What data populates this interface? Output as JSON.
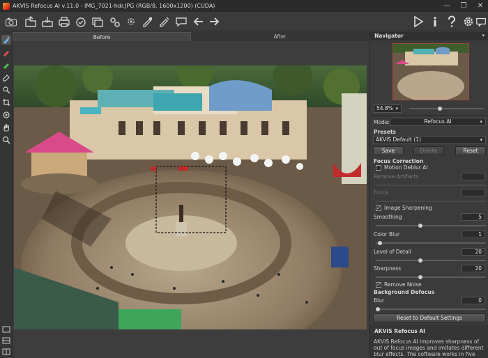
{
  "window": {
    "title": "AKVIS Refocus AI v.11.0 - IMG_7021-hdr.JPG (RGB/8, 1600x1200) (CUDA)"
  },
  "tabs": {
    "before": "Before",
    "after": "After"
  },
  "navigator": {
    "header": "Navigator",
    "zoom": "54.8%"
  },
  "mode": {
    "label": "Mode:",
    "value": "Refocus AI"
  },
  "presets": {
    "label": "Presets",
    "value": "AKVIS Default (1)",
    "save": "Save",
    "delete": "Delete",
    "reset": "Reset"
  },
  "focus": {
    "header": "Focus Correction",
    "motion_deblur": "Motion Deblur AI",
    "remove_artifacts": {
      "label": "Remove Artifacts",
      "value": ""
    },
    "focus": {
      "label": "Focus",
      "value": ""
    }
  },
  "sharpening": {
    "header": "Image Sharpening",
    "smoothing": {
      "label": "Smoothing",
      "value": "5",
      "level": 0.4
    },
    "color_blur": {
      "label": "Color Blur",
      "value": "1",
      "level": 0.02
    },
    "level_of_detail": {
      "label": "Level of Detail",
      "value": "20",
      "level": 0.4
    },
    "sharpness": {
      "label": "Sharpness",
      "value": "20",
      "level": 0.4
    },
    "remove_noise": "Remove Noise"
  },
  "defocus": {
    "header": "Background Defocus",
    "blur": {
      "label": "Blur",
      "value": "0",
      "level": 0
    }
  },
  "reset_defaults": "Reset to Default Settings",
  "help": {
    "title": "AKVIS Refocus AI",
    "body": "AKVIS Refocus AI improves sharpness of out of focus images and imitates different blur effects. The software works in five modes: Refocus AI,"
  },
  "icons": [
    "camera-icon",
    "open-icon",
    "save-icon",
    "print-icon",
    "share-icon",
    "batch-icon",
    "settings-gear-icon",
    "preferences-icon",
    "plugin-icon",
    "comment-icon",
    "undo-arrow-icon",
    "redo-arrow-icon",
    "run-play-icon",
    "info-icon",
    "help-icon",
    "gear-icon",
    "message-icon"
  ]
}
